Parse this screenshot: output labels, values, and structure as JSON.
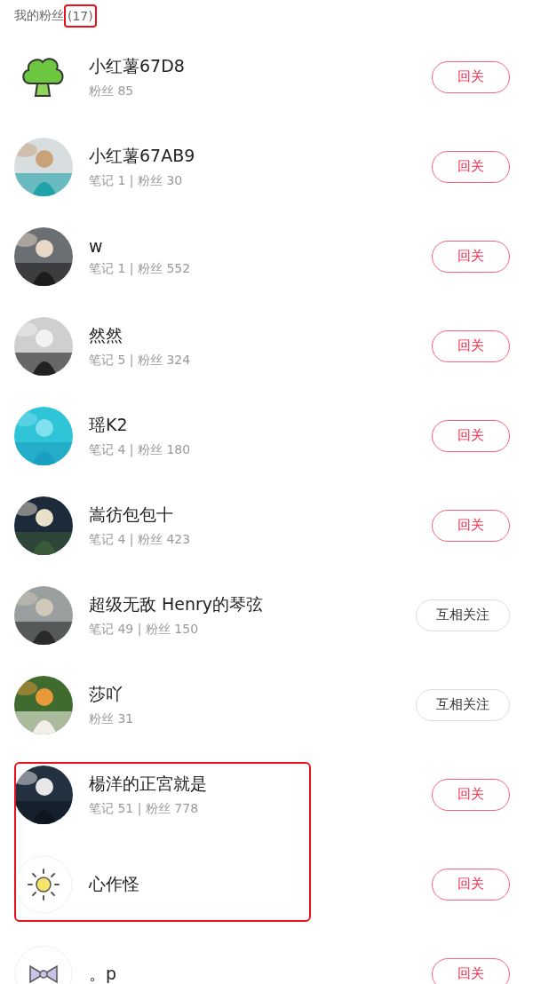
{
  "header": {
    "title": "我的粉丝",
    "count": "(17)",
    "count_highlighted": true
  },
  "followers": [
    {
      "name": "小红薯67D8",
      "stats": "粉丝 85",
      "avatar": {
        "kind": "broccoli"
      },
      "button": {
        "kind": "follow_back",
        "label": "回关"
      },
      "highlighted": false
    },
    {
      "name": "小红薯67AB9",
      "stats": "笔记 1 | 粉丝 30",
      "button": {
        "kind": "follow_back",
        "label": "回关"
      },
      "highlighted": false
    },
    {
      "name": "w",
      "stats": "笔记 1 | 粉丝 552",
      "button": {
        "kind": "follow_back",
        "label": "回关"
      },
      "highlighted": false
    },
    {
      "name": "然然",
      "stats": "笔记 5 | 粉丝 324",
      "button": {
        "kind": "follow_back",
        "label": "回关"
      },
      "highlighted": false
    },
    {
      "name": "瑶K2",
      "stats": "笔记 4 | 粉丝 180",
      "button": {
        "kind": "follow_back",
        "label": "回关"
      },
      "highlighted": false
    },
    {
      "name": "嵩彷包包十",
      "stats": "笔记 4 | 粉丝 423",
      "button": {
        "kind": "follow_back",
        "label": "回关"
      },
      "highlighted": false
    },
    {
      "name": "超级无敌 Henry的琴弦",
      "stats": "笔记 49 | 粉丝 150",
      "button": {
        "kind": "mutual",
        "label": "互相关注"
      },
      "highlighted": false
    },
    {
      "name": "莎吖",
      "stats": "粉丝 31",
      "button": {
        "kind": "mutual",
        "label": "互相关注"
      },
      "highlighted": false
    },
    {
      "name": "楊洋的正宮就是",
      "stats": "笔记 51 | 粉丝 778",
      "button": {
        "kind": "follow_back",
        "label": "回关"
      },
      "highlighted": true
    },
    {
      "name": "心作怪",
      "avatar": {
        "kind": "sun"
      },
      "button": {
        "kind": "follow_back",
        "label": "回关"
      },
      "highlighted": true
    },
    {
      "name": "。p",
      "avatar": {
        "kind": "bow"
      },
      "button": {
        "kind": "follow_back",
        "label": "回关"
      },
      "highlighted": false
    }
  ]
}
